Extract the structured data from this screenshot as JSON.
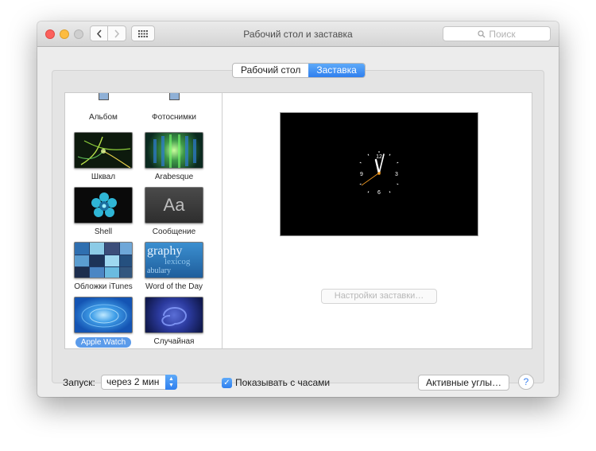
{
  "window": {
    "title": "Рабочий стол и заставка"
  },
  "search": {
    "placeholder": "Поиск"
  },
  "tabs": [
    {
      "label": "Рабочий стол",
      "active": false
    },
    {
      "label": "Заставка",
      "active": true
    }
  ],
  "screensavers": [
    {
      "label": "Альбом",
      "icon": "monitor-icon"
    },
    {
      "label": "Фотоснимки",
      "icon": "monitor-icon"
    },
    {
      "label": "Шквал"
    },
    {
      "label": "Arabesque"
    },
    {
      "label": "Shell"
    },
    {
      "label": "Сообщение",
      "thumb_text": "Aa"
    },
    {
      "label": "Обложки iTunes"
    },
    {
      "label": "Word of the Day",
      "thumb_words": [
        "graphy",
        "lexicog",
        "abulary"
      ]
    },
    {
      "label": "Apple Watch",
      "selected": true
    },
    {
      "label": "Случайная"
    }
  ],
  "preview": {
    "clock_numbers": [
      "12",
      "3",
      "6",
      "9"
    ]
  },
  "options_button": "Настройки заставки…",
  "start": {
    "label": "Запуск:",
    "value": "через 2 мин"
  },
  "show_clock": {
    "label": "Показывать с часами",
    "checked": true
  },
  "hot_corners_button": "Активные углы…",
  "help_button": "?",
  "colors": {
    "accent": "#3a8bf4",
    "traffic_close": "#fc605c",
    "traffic_min": "#fdbc40"
  }
}
